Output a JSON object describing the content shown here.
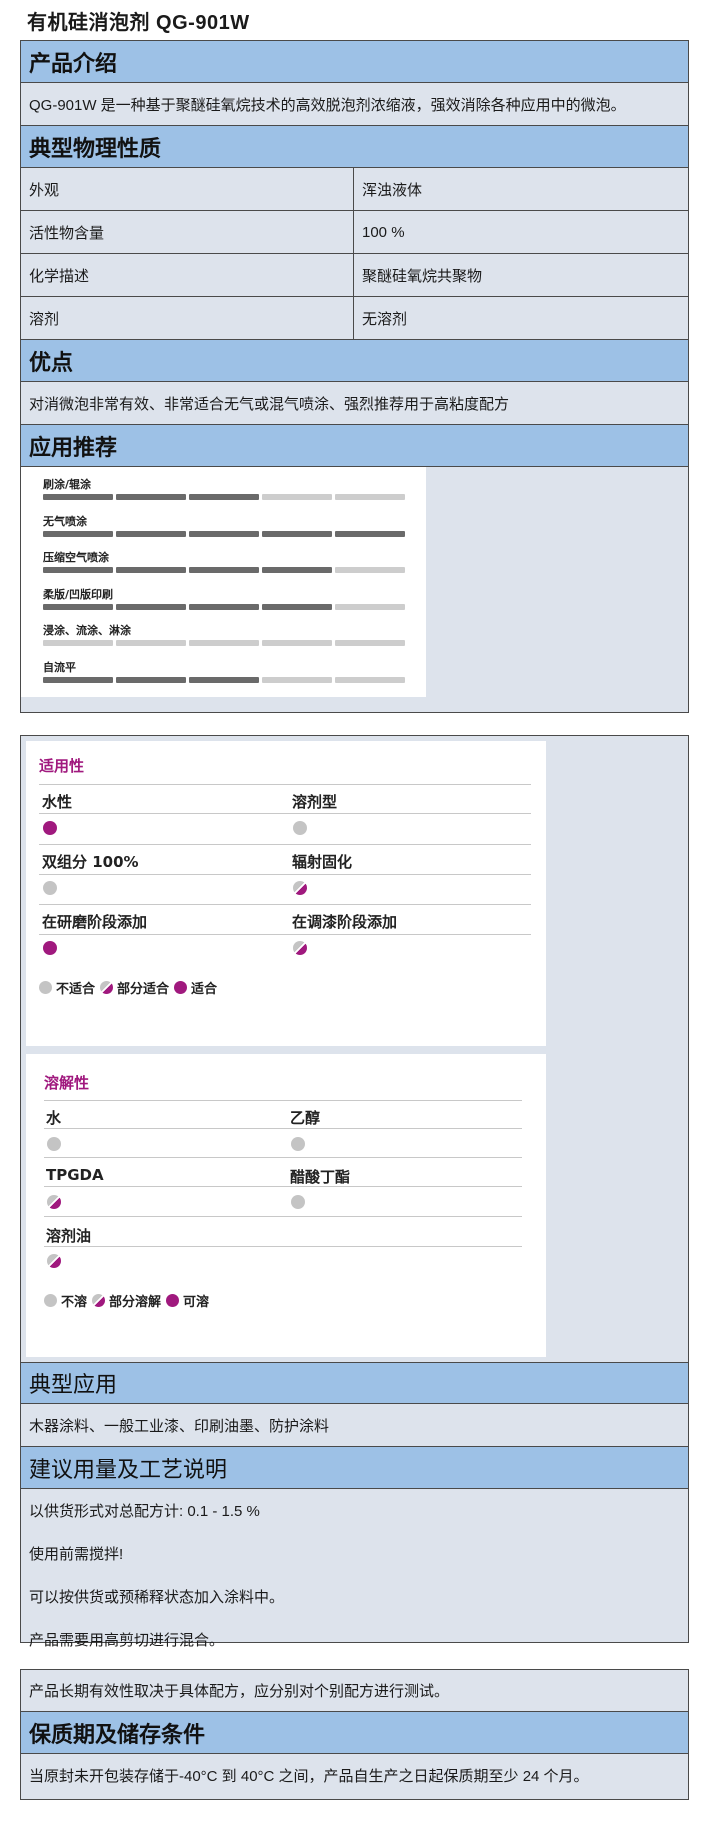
{
  "title": "有机硅消泡剂  QG-901W",
  "intro": {
    "heading": "产品介绍",
    "text": "QG-901W 是一种基于聚醚硅氧烷技术的高效脱泡剂浓缩液，强效消除各种应用中的微泡。"
  },
  "properties": {
    "heading": "典型物理性质",
    "rows": [
      {
        "key": "外观",
        "value": "浑浊液体"
      },
      {
        "key": "活性物含量",
        "value": "100 %"
      },
      {
        "key": "化学描述",
        "value": "聚醚硅氧烷共聚物"
      },
      {
        "key": "溶剂",
        "value": "无溶剂"
      }
    ]
  },
  "advantages": {
    "heading": "优点",
    "text": "对消微泡非常有效、非常适合无气或混气喷涂、强烈推荐用于高粘度配方"
  },
  "recommend": {
    "heading": "应用推荐",
    "items": [
      {
        "label": "刷涂/辊涂",
        "level": 3
      },
      {
        "label": "无气喷涂",
        "level": 5
      },
      {
        "label": "压缩空气喷涂",
        "level": 4
      },
      {
        "label": "柔版/凹版印刷",
        "level": 4
      },
      {
        "label": "浸涂、流涂、淋涂",
        "level": 0
      },
      {
        "label": "自流平",
        "level": 3
      }
    ],
    "max_level": 5
  },
  "suitability": {
    "title": "适用性",
    "items": [
      {
        "label": "水性",
        "rating": "full"
      },
      {
        "label": "溶剂型",
        "rating": "none"
      },
      {
        "label": "双组分 100%",
        "rating": "none"
      },
      {
        "label": "辐射固化",
        "rating": "half"
      },
      {
        "label": "在研磨阶段添加",
        "rating": "full"
      },
      {
        "label": "在调漆阶段添加",
        "rating": "half"
      }
    ],
    "legend": {
      "none": "不适合",
      "half": "部分适合",
      "full": "适合"
    }
  },
  "solubility": {
    "title": "溶解性",
    "items": [
      {
        "label": "水",
        "rating": "none"
      },
      {
        "label": "乙醇",
        "rating": "none"
      },
      {
        "label": "TPGDA",
        "rating": "half"
      },
      {
        "label": "醋酸丁酯",
        "rating": "none"
      },
      {
        "label": "溶剂油",
        "rating": "half"
      }
    ],
    "legend": {
      "none": "不溶",
      "half": "部分溶解",
      "full": "可溶"
    }
  },
  "applications": {
    "heading": "典型应用",
    "text": "木器涂料、一般工业漆、印刷油墨、防护涂料"
  },
  "usage": {
    "heading": "建议用量及工艺说明",
    "lines": [
      "以供货形式对总配方计: 0.1 - 1.5 %",
      "使用前需搅拌!",
      "可以按供货或预稀释状态加入涂料中。",
      "产品需要用高剪切进行混合。"
    ]
  },
  "validity": {
    "text": "产品长期有效性取决于具体配方，应分别对个别配方进行测试。"
  },
  "storage": {
    "heading": "保质期及储存条件",
    "text": "当原封未开包装存储于-40°C 到 40°C 之间，产品自生产之日起保质期至少 24 个月。"
  },
  "colors": {
    "header_blue": "#9dc1e6",
    "body_grey": "#dde3ec",
    "magenta": "#a0197e",
    "dot_grey": "#c4c4c4"
  }
}
